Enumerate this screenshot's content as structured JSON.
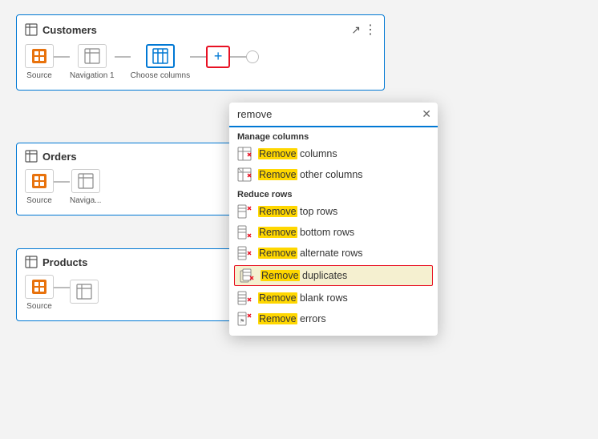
{
  "cards": {
    "customers": {
      "title": "Customers",
      "steps": [
        {
          "label": "Source",
          "type": "source"
        },
        {
          "label": "Navigation 1",
          "type": "nav"
        },
        {
          "label": "Choose columns",
          "type": "choose"
        }
      ]
    },
    "orders": {
      "title": "Orders",
      "steps": [
        {
          "label": "Source",
          "type": "source"
        },
        {
          "label": "Naviga...",
          "type": "nav"
        }
      ]
    },
    "products": {
      "title": "Products",
      "steps": [
        {
          "label": "Source",
          "type": "source"
        }
      ]
    }
  },
  "search": {
    "value": "remove",
    "placeholder": "Search"
  },
  "dropdown": {
    "sections": [
      {
        "label": "Manage columns",
        "items": [
          {
            "text_before": "",
            "highlight": "Remove",
            "text_after": " columns",
            "icon_type": "remove-cols",
            "highlighted": false
          },
          {
            "text_before": "",
            "highlight": "Remove",
            "text_after": " other columns",
            "icon_type": "remove-other-cols",
            "highlighted": false
          }
        ]
      },
      {
        "label": "Reduce rows",
        "items": [
          {
            "text_before": "",
            "highlight": "Remove",
            "text_after": " top rows",
            "icon_type": "remove-top",
            "highlighted": false
          },
          {
            "text_before": "",
            "highlight": "Remove",
            "text_after": " bottom rows",
            "icon_type": "remove-bottom",
            "highlighted": false
          },
          {
            "text_before": "",
            "highlight": "Remove",
            "text_after": " alternate rows",
            "icon_type": "remove-alt",
            "highlighted": false
          },
          {
            "text_before": "",
            "highlight": "Remove",
            "text_after": " duplicates",
            "icon_type": "remove-dupes",
            "highlighted": true
          },
          {
            "text_before": "",
            "highlight": "Remove",
            "text_after": " blank rows",
            "icon_type": "remove-blank",
            "highlighted": false
          },
          {
            "text_before": "",
            "highlight": "Remove",
            "text_after": " errors",
            "icon_type": "remove-errors",
            "highlighted": false
          }
        ]
      }
    ]
  }
}
